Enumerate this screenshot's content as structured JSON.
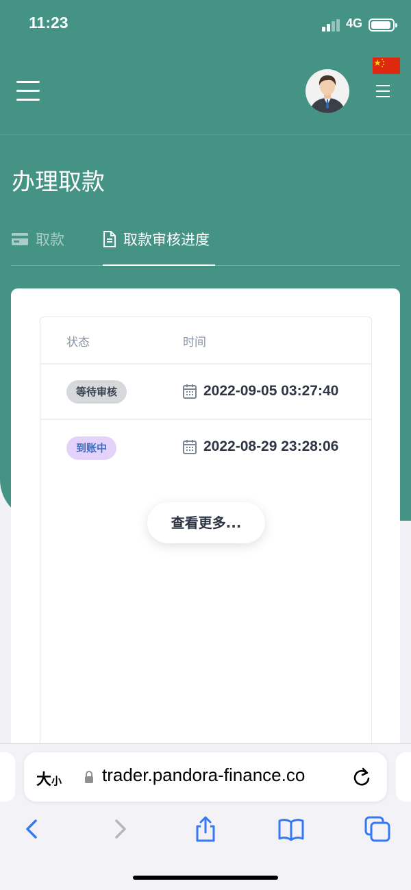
{
  "status_bar": {
    "time": "11:23",
    "network": "4G"
  },
  "header": {
    "menu_icon": "hamburger-icon",
    "avatar_icon": "user-avatar-icon",
    "flag_icon": "china-flag-icon",
    "more_icon": "menu-lines-icon"
  },
  "page": {
    "title": "办理取款"
  },
  "tabs": [
    {
      "label": "取款",
      "icon": "credit-card-icon",
      "active": false
    },
    {
      "label": "取款审核进度",
      "icon": "document-icon",
      "active": true
    }
  ],
  "table": {
    "columns": [
      "状态",
      "时间"
    ],
    "rows": [
      {
        "status": "等待审核",
        "time": "2022-09-05 03:27:40"
      },
      {
        "status": "到账中",
        "time": "2022-08-29 23:28:06"
      }
    ],
    "load_more": "查看更多..."
  },
  "browser": {
    "text_size_label": "大",
    "text_size_small": "小",
    "url": "trader.pandora-finance.co"
  },
  "colors": {
    "primary": "#449385",
    "badge_wait": "#d6d8dc",
    "badge_transit": "#e4d2fb",
    "ios_blue": "#3478f6"
  }
}
